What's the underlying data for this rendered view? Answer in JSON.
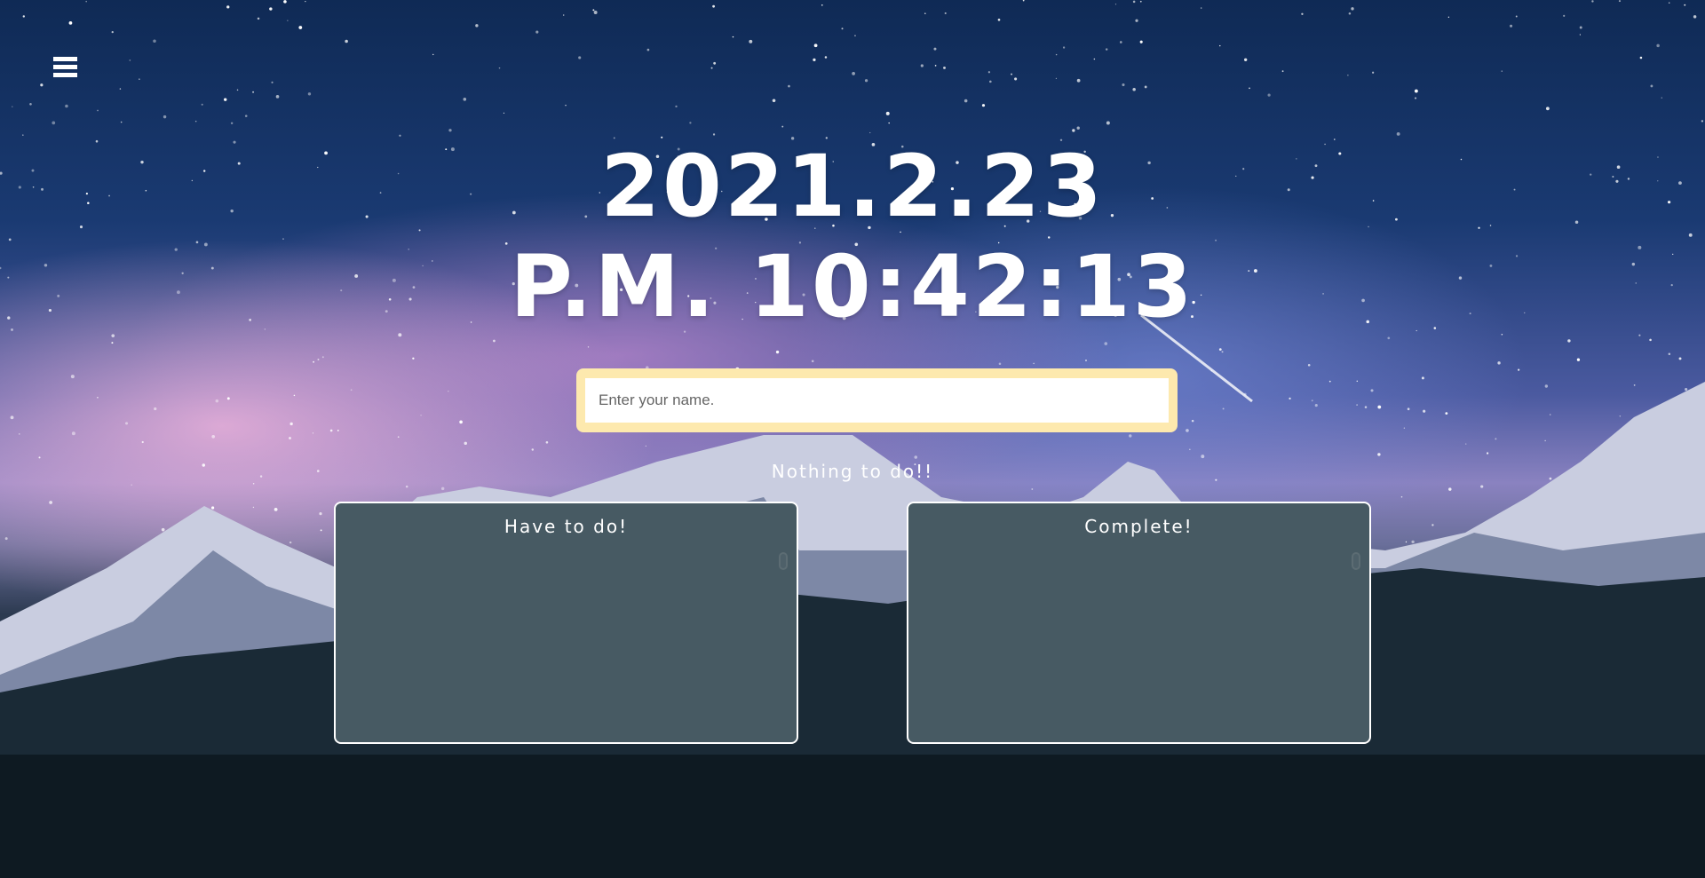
{
  "menu": {
    "icon": "hamburger-menu-icon"
  },
  "clock": {
    "date": "2021.2.23",
    "time": "P.M. 10:42:13"
  },
  "name_form": {
    "placeholder": "Enter your name.",
    "value": ""
  },
  "status": "Nothing to do!!",
  "lists": [
    {
      "title": "Have to do!",
      "items": []
    },
    {
      "title": "Complete!",
      "items": []
    }
  ],
  "colors": {
    "name_frame": "#fde9ae",
    "list_bg": "#475a63"
  }
}
